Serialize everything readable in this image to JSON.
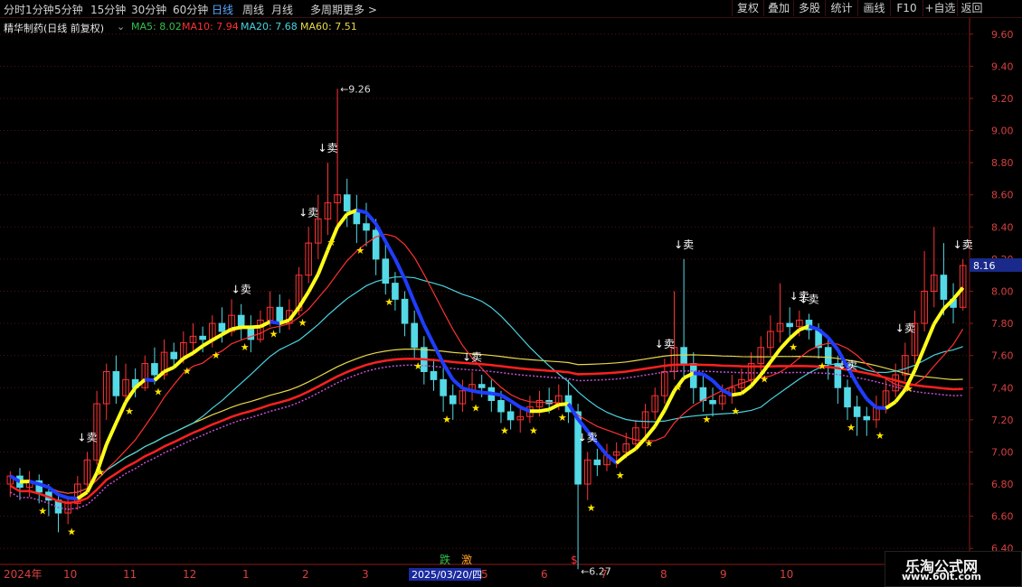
{
  "toolbar": {
    "periods": [
      "分时",
      "1分钟",
      "5分钟",
      "15分钟",
      "30分钟",
      "60分钟",
      "日线",
      "周线",
      "月线",
      "多周期",
      "更多"
    ],
    "active_period": "日线",
    "tools": [
      "复权",
      "叠加",
      "多股",
      "统计",
      "画线",
      "F10",
      "+自选",
      "返回"
    ]
  },
  "legend": {
    "stock": "精华制药(日线 前复权)",
    "ma5": "MA5: 8.02",
    "ma10": "MA10: 7.94",
    "ma20": "MA20: 7.68",
    "ma60": "MA60: 7.51"
  },
  "colors": {
    "ma5": "#33c24a",
    "ma10": "#ff3030",
    "ma20": "#49d2e0",
    "ma60": "#e8d84a",
    "up": "#ff3333",
    "down": "#54d9e6",
    "yellow": "#ffff1a",
    "blue": "#1f3dff"
  },
  "chart_data": {
    "type": "candlestick",
    "price_axis": {
      "min": 6.3,
      "max": 9.7,
      "ticks": [
        "9.60",
        "9.40",
        "9.20",
        "9.00",
        "8.80",
        "8.60",
        "8.40",
        "8.20",
        "8.00",
        "7.80",
        "7.60",
        "7.40",
        "7.20",
        "7.00",
        "6.80",
        "6.60",
        "6.40"
      ]
    },
    "current_price": "8.16",
    "high_marker": "9.26",
    "low_marker": "6.27",
    "months": [
      "2024年",
      "10",
      "11",
      "12",
      "1",
      "2",
      "3",
      "4",
      "5",
      "6",
      "7",
      "8",
      "9",
      "10"
    ],
    "crosshair_date": "2025/03/20/四",
    "sell_signal": "↓卖",
    "sell_signal_count": 13,
    "star_signal_count": 31,
    "bottom_labels": {
      "die": "跌",
      "ji": "激",
      "dollar": "$"
    },
    "candles": [
      [
        6.8,
        6.85,
        6.72,
        6.88
      ],
      [
        6.85,
        6.78,
        6.7,
        6.9
      ],
      [
        6.78,
        6.82,
        6.72,
        6.88
      ],
      [
        6.82,
        6.75,
        6.68,
        6.86
      ],
      [
        6.75,
        6.7,
        6.6,
        6.8
      ],
      [
        6.7,
        6.62,
        6.5,
        6.74
      ],
      [
        6.62,
        6.68,
        6.55,
        6.72
      ],
      [
        6.68,
        6.8,
        6.64,
        6.85
      ],
      [
        6.8,
        6.95,
        6.78,
        7.0
      ],
      [
        6.95,
        7.3,
        6.92,
        7.38
      ],
      [
        7.3,
        7.5,
        7.2,
        7.55
      ],
      [
        7.5,
        7.35,
        7.3,
        7.6
      ],
      [
        7.35,
        7.45,
        7.3,
        7.55
      ],
      [
        7.45,
        7.4,
        7.34,
        7.52
      ],
      [
        7.4,
        7.55,
        7.38,
        7.6
      ],
      [
        7.55,
        7.48,
        7.42,
        7.65
      ],
      [
        7.48,
        7.62,
        7.45,
        7.7
      ],
      [
        7.62,
        7.58,
        7.52,
        7.68
      ],
      [
        7.58,
        7.68,
        7.55,
        7.75
      ],
      [
        7.68,
        7.72,
        7.6,
        7.8
      ],
      [
        7.72,
        7.7,
        7.62,
        7.78
      ],
      [
        7.7,
        7.8,
        7.65,
        7.85
      ],
      [
        7.8,
        7.75,
        7.68,
        7.9
      ],
      [
        7.75,
        7.85,
        7.72,
        7.95
      ],
      [
        7.85,
        7.78,
        7.7,
        7.92
      ],
      [
        7.78,
        7.7,
        7.62,
        7.85
      ],
      [
        7.7,
        7.82,
        7.68,
        7.88
      ],
      [
        7.82,
        7.9,
        7.78,
        8.0
      ],
      [
        7.9,
        7.8,
        7.74,
        7.98
      ],
      [
        7.8,
        7.88,
        7.76,
        7.95
      ],
      [
        7.88,
        8.1,
        7.85,
        8.15
      ],
      [
        8.1,
        8.3,
        8.05,
        8.4
      ],
      [
        8.3,
        8.45,
        8.2,
        8.6
      ],
      [
        8.45,
        8.55,
        8.35,
        8.8
      ],
      [
        8.55,
        8.6,
        8.4,
        9.26
      ],
      [
        8.6,
        8.5,
        8.4,
        8.7
      ],
      [
        8.5,
        8.42,
        8.3,
        8.6
      ],
      [
        8.42,
        8.38,
        8.28,
        8.55
      ],
      [
        8.38,
        8.2,
        8.1,
        8.45
      ],
      [
        8.2,
        8.05,
        7.98,
        8.3
      ],
      [
        8.05,
        7.95,
        7.88,
        8.12
      ],
      [
        7.95,
        7.8,
        7.72,
        8.0
      ],
      [
        7.8,
        7.65,
        7.58,
        7.88
      ],
      [
        7.65,
        7.5,
        7.42,
        7.72
      ],
      [
        7.5,
        7.45,
        7.38,
        7.58
      ],
      [
        7.45,
        7.35,
        7.25,
        7.52
      ],
      [
        7.35,
        7.3,
        7.2,
        7.42
      ],
      [
        7.3,
        7.38,
        7.25,
        7.45
      ],
      [
        7.38,
        7.42,
        7.32,
        7.5
      ],
      [
        7.42,
        7.4,
        7.34,
        7.48
      ],
      [
        7.4,
        7.32,
        7.25,
        7.45
      ],
      [
        7.32,
        7.25,
        7.18,
        7.38
      ],
      [
        7.25,
        7.2,
        7.14,
        7.3
      ],
      [
        7.2,
        7.22,
        7.12,
        7.28
      ],
      [
        7.22,
        7.28,
        7.18,
        7.35
      ],
      [
        7.28,
        7.32,
        7.22,
        7.38
      ],
      [
        7.32,
        7.3,
        7.24,
        7.4
      ],
      [
        7.3,
        7.35,
        7.26,
        7.42
      ],
      [
        7.35,
        7.25,
        7.18,
        7.45
      ],
      [
        7.25,
        6.8,
        6.27,
        7.3
      ],
      [
        6.8,
        6.95,
        6.7,
        7.0
      ],
      [
        6.95,
        6.92,
        6.85,
        7.02
      ],
      [
        6.92,
        6.98,
        6.88,
        7.05
      ],
      [
        6.98,
        7.0,
        6.9,
        7.06
      ],
      [
        7.0,
        7.05,
        6.96,
        7.12
      ],
      [
        7.05,
        7.15,
        7.02,
        7.2
      ],
      [
        7.15,
        7.25,
        7.1,
        7.3
      ],
      [
        7.25,
        7.35,
        7.2,
        7.4
      ],
      [
        7.35,
        7.5,
        7.3,
        7.58
      ],
      [
        7.5,
        7.65,
        7.45,
        8.0
      ],
      [
        7.65,
        7.55,
        7.45,
        8.2
      ],
      [
        7.55,
        7.4,
        7.3,
        7.62
      ],
      [
        7.4,
        7.32,
        7.25,
        7.48
      ],
      [
        7.32,
        7.3,
        7.22,
        7.4
      ],
      [
        7.3,
        7.35,
        7.26,
        7.42
      ],
      [
        7.35,
        7.4,
        7.3,
        7.48
      ],
      [
        7.4,
        7.45,
        7.36,
        7.52
      ],
      [
        7.45,
        7.55,
        7.4,
        7.62
      ],
      [
        7.55,
        7.65,
        7.5,
        7.72
      ],
      [
        7.65,
        7.75,
        7.6,
        7.85
      ],
      [
        7.75,
        7.8,
        7.68,
        8.05
      ],
      [
        7.8,
        7.78,
        7.7,
        7.9
      ],
      [
        7.78,
        7.82,
        7.72,
        7.88
      ],
      [
        7.82,
        7.76,
        7.7,
        7.86
      ],
      [
        7.76,
        7.65,
        7.58,
        7.8
      ],
      [
        7.65,
        7.55,
        7.45,
        7.7
      ],
      [
        7.55,
        7.4,
        7.3,
        7.6
      ],
      [
        7.4,
        7.28,
        7.2,
        7.45
      ],
      [
        7.28,
        7.22,
        7.1,
        7.35
      ],
      [
        7.22,
        7.2,
        7.1,
        7.28
      ],
      [
        7.2,
        7.28,
        7.15,
        7.35
      ],
      [
        7.28,
        7.38,
        7.24,
        7.45
      ],
      [
        7.38,
        7.48,
        7.34,
        7.55
      ],
      [
        7.48,
        7.6,
        7.44,
        7.68
      ],
      [
        7.6,
        7.8,
        7.55,
        7.88
      ],
      [
        7.8,
        8.0,
        7.75,
        8.25
      ],
      [
        8.0,
        8.1,
        7.9,
        8.4
      ],
      [
        8.1,
        7.95,
        7.85,
        8.3
      ],
      [
        7.95,
        7.9,
        7.8,
        8.05
      ],
      [
        7.9,
        8.16,
        7.88,
        8.2
      ]
    ]
  }
}
